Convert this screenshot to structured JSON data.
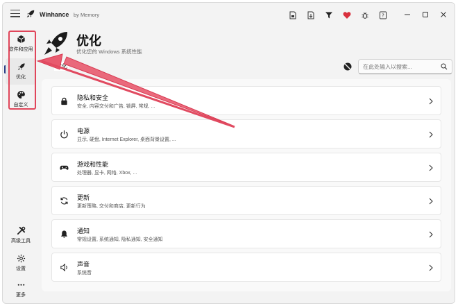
{
  "titlebar": {
    "app_name": "Winhance",
    "app_by": "by Memory",
    "icons": [
      "save-config-icon",
      "import-config-icon",
      "filter-icon",
      "donate-heart-icon",
      "bug-report-icon",
      "help-icon"
    ],
    "window_controls": [
      "minimize-icon",
      "maximize-icon",
      "close-icon"
    ]
  },
  "sidebar": {
    "items": [
      {
        "label": "软件和应用",
        "icon": "package-icon"
      },
      {
        "label": "优化",
        "icon": "rocket-icon"
      },
      {
        "label": "自定义",
        "icon": "palette-icon"
      }
    ],
    "bottom_items": [
      {
        "label": "高级工具",
        "icon": "tools-icon"
      },
      {
        "label": "设置",
        "icon": "gear-icon"
      },
      {
        "label": "更多",
        "icon": "more-icon"
      }
    ]
  },
  "header": {
    "title": "优化",
    "subtitle": "优化您的 Windows 系统性能",
    "breadcrumb": "优化"
  },
  "search": {
    "placeholder": "在此处输入以搜索..."
  },
  "sections": [
    {
      "title": "隐私和安全",
      "desc": "安全, 内容交付和广告, 锁屏, 常规, ...",
      "icon": "lock-icon"
    },
    {
      "title": "电源",
      "desc": "显示, 硬盘, Internet Explorer, 桌面背景设置, ...",
      "icon": "power-icon"
    },
    {
      "title": "游戏和性能",
      "desc": "处理器, 显卡, 网络, Xbox, ...",
      "icon": "gamepad-icon"
    },
    {
      "title": "更新",
      "desc": "更新策略, 交付和商店, 更新行为",
      "icon": "refresh-icon"
    },
    {
      "title": "通知",
      "desc": "常规设置, 系统通知, 隐私通知, 安全通知",
      "icon": "bell-icon"
    },
    {
      "title": "声音",
      "desc": "系统音",
      "icon": "speaker-icon"
    }
  ],
  "colors": {
    "highlight": "#e0455a",
    "accent": "#2a3f86",
    "heart": "#d9303d"
  }
}
